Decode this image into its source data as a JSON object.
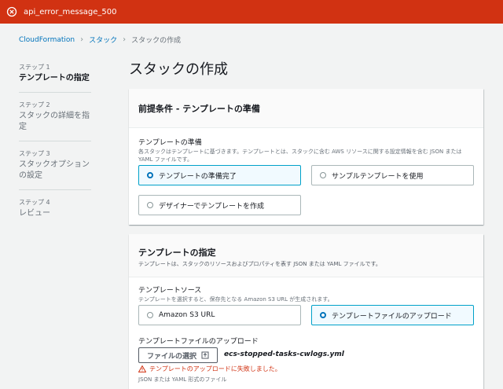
{
  "error_bar": {
    "message": "api_error_message_500",
    "color": "#d13212"
  },
  "breadcrumb": [
    "CloudFormation",
    "スタック",
    "スタックの作成"
  ],
  "steps": [
    {
      "num": "ステップ 1",
      "title": "テンプレートの指定",
      "active": true
    },
    {
      "num": "ステップ 2",
      "title": "スタックの詳細を指定",
      "active": false
    },
    {
      "num": "ステップ 3",
      "title": "スタックオプションの設定",
      "active": false
    },
    {
      "num": "ステップ 4",
      "title": "レビュー",
      "active": false
    }
  ],
  "page_title": "スタックの作成",
  "prereq": {
    "title": "前提条件 - テンプレートの準備",
    "field_label": "テンプレートの準備",
    "field_desc": "各スタックはテンプレートに基づきます。テンプレートとは、スタックに含む AWS リソースに関する設定情報を含む JSON または YAML ファイルです。",
    "options": [
      "テンプレートの準備完了",
      "サンプルテンプレートを使用",
      "デザイナーでテンプレートを作成"
    ],
    "selected": "テンプレートの準備完了"
  },
  "spec": {
    "title": "テンプレートの指定",
    "desc": "テンプレートは、スタックのリソースおよびプロパティを表す JSON または YAML ファイルです。",
    "source_label": "テンプレートソース",
    "source_desc": "テンプレートを選択すると、保存先となる Amazon S3 URL が生成されます。",
    "source_options": [
      "Amazon S3 URL",
      "テンプレートファイルのアップロード"
    ],
    "selected": "テンプレートファイルのアップロード",
    "upload_label": "テンプレートファイルのアップロード",
    "file_button": "ファイルの選択",
    "file_name": "ecs-stopped-tasks-cwlogs.yml",
    "upload_error": "テンプレートのアップロードに失敗しました。",
    "format_hint": "JSON または YAML 形式のファイル"
  },
  "colors": {
    "link": "#0073bb",
    "selected_border": "#00a1c9",
    "error": "#d13212"
  }
}
